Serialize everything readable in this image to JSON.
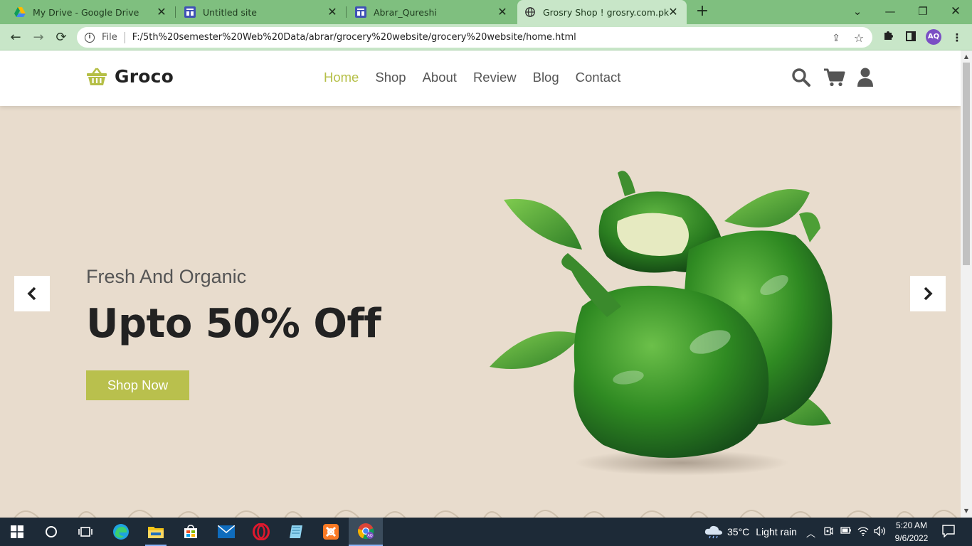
{
  "browser": {
    "tabs": [
      {
        "title": "My Drive - Google Drive",
        "icon": "google-drive-icon"
      },
      {
        "title": "Untitled site",
        "icon": "google-sites-icon"
      },
      {
        "title": "Abrar_Qureshi",
        "icon": "google-sites-icon"
      },
      {
        "title": "Grosry Shop ! grosry.com.pk",
        "icon": "globe-icon",
        "active": true
      }
    ],
    "address": {
      "scheme": "File",
      "url": "F:/5th%20semester%20Web%20Data/abrar/grocery%20website/grocery%20website/home.html"
    },
    "profile_initials": "AQ"
  },
  "site": {
    "logo": "Groco",
    "nav": [
      {
        "label": "Home",
        "active": true
      },
      {
        "label": "Shop"
      },
      {
        "label": "About"
      },
      {
        "label": "Review"
      },
      {
        "label": "Blog"
      },
      {
        "label": "Contact"
      }
    ],
    "hero": {
      "subtitle": "Fresh And Organic",
      "title": "Upto 50% Off",
      "cta": "Shop Now"
    },
    "colors": {
      "accent": "#b5bf47",
      "hero_bg": "#e8dccd",
      "text": "#222222"
    }
  },
  "taskbar": {
    "weather": {
      "temp": "35°C",
      "condition": "Light rain"
    },
    "time": "5:20 AM",
    "date": "9/6/2022"
  }
}
